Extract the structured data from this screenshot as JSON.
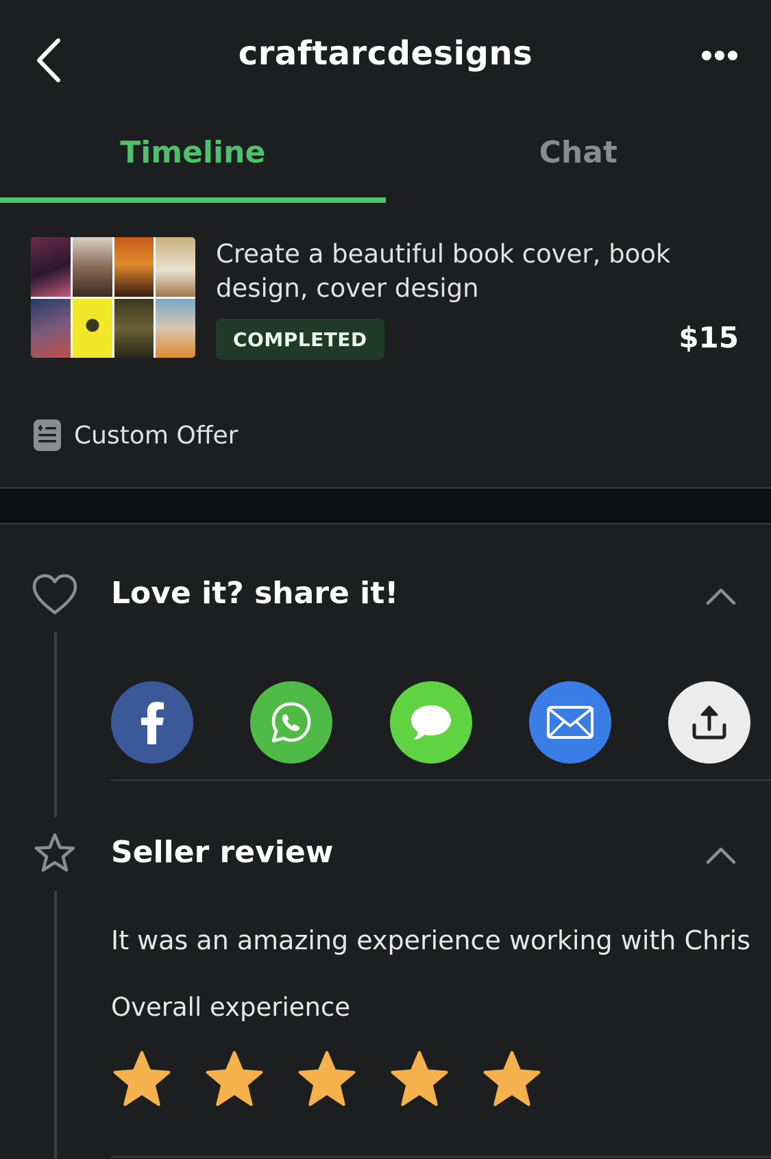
{
  "header": {
    "title": "craftarcdesigns",
    "back_icon": "chevron-left-icon",
    "more_icon": "more-horizontal-icon"
  },
  "tabs": [
    {
      "label": "Timeline",
      "active": true
    },
    {
      "label": "Chat",
      "active": false
    }
  ],
  "order": {
    "title": "Create a beautiful book cover, book design, cover design",
    "status": "COMPLETED",
    "price": "$15",
    "offer_type": "Custom Offer",
    "offer_icon": "list-document-icon"
  },
  "share": {
    "title": "Love it? share it!",
    "icon": "heart-outline-icon",
    "collapse_icon": "chevron-up-icon",
    "options": [
      {
        "name": "facebook",
        "icon": "facebook-icon",
        "color": "#3b5998"
      },
      {
        "name": "whatsapp",
        "icon": "whatsapp-icon",
        "color": "#4fba45"
      },
      {
        "name": "messages",
        "icon": "chat-bubble-icon",
        "color": "#5fd341"
      },
      {
        "name": "email",
        "icon": "mail-icon",
        "color": "#3b7de7"
      },
      {
        "name": "more-share",
        "icon": "share-upload-icon",
        "color": "#ececec"
      }
    ]
  },
  "review": {
    "title": "Seller review",
    "icon": "star-outline-icon",
    "collapse_icon": "chevron-up-icon",
    "text": "It was an amazing experience working with Chris",
    "overall_label": "Overall experience",
    "rating": 5,
    "rating_max": 5,
    "star_color": "#f5b14c"
  },
  "colors": {
    "accent": "#4fc06d",
    "background": "#1d1e20",
    "badge_bg": "#1f3b28"
  }
}
